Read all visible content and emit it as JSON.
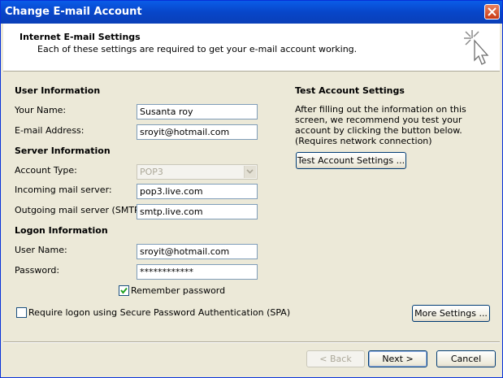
{
  "window": {
    "title": "Change E-mail Account"
  },
  "header": {
    "title": "Internet E-mail Settings",
    "subtitle": "Each of these settings are required to get your e-mail account working."
  },
  "user_info": {
    "heading": "User Information",
    "name_label": "Your Name:",
    "name_value": "Susanta roy",
    "email_label": "E-mail Address:",
    "email_value": "sroyit@hotmail.com"
  },
  "server_info": {
    "heading": "Server Information",
    "account_type_label": "Account Type:",
    "account_type_value": "POP3",
    "incoming_label": "Incoming mail server:",
    "incoming_value": "pop3.live.com",
    "outgoing_label": "Outgoing mail server (SMTP):",
    "outgoing_value": "smtp.live.com"
  },
  "logon_info": {
    "heading": "Logon Information",
    "username_label": "User Name:",
    "username_value": "sroyit@hotmail.com",
    "password_label": "Password:",
    "password_value": "************",
    "remember_label": "Remember password",
    "remember_checked": true,
    "spa_label": "Require logon using Secure Password Authentication (SPA)",
    "spa_checked": false
  },
  "test_settings": {
    "heading": "Test Account Settings",
    "description": "After filling out the information on this screen, we recommend you test your account by clicking the button below. (Requires network connection)",
    "button_label": "Test Account Settings ..."
  },
  "buttons": {
    "more_settings": "More Settings ...",
    "back": "< Back",
    "next": "Next >",
    "cancel": "Cancel"
  }
}
